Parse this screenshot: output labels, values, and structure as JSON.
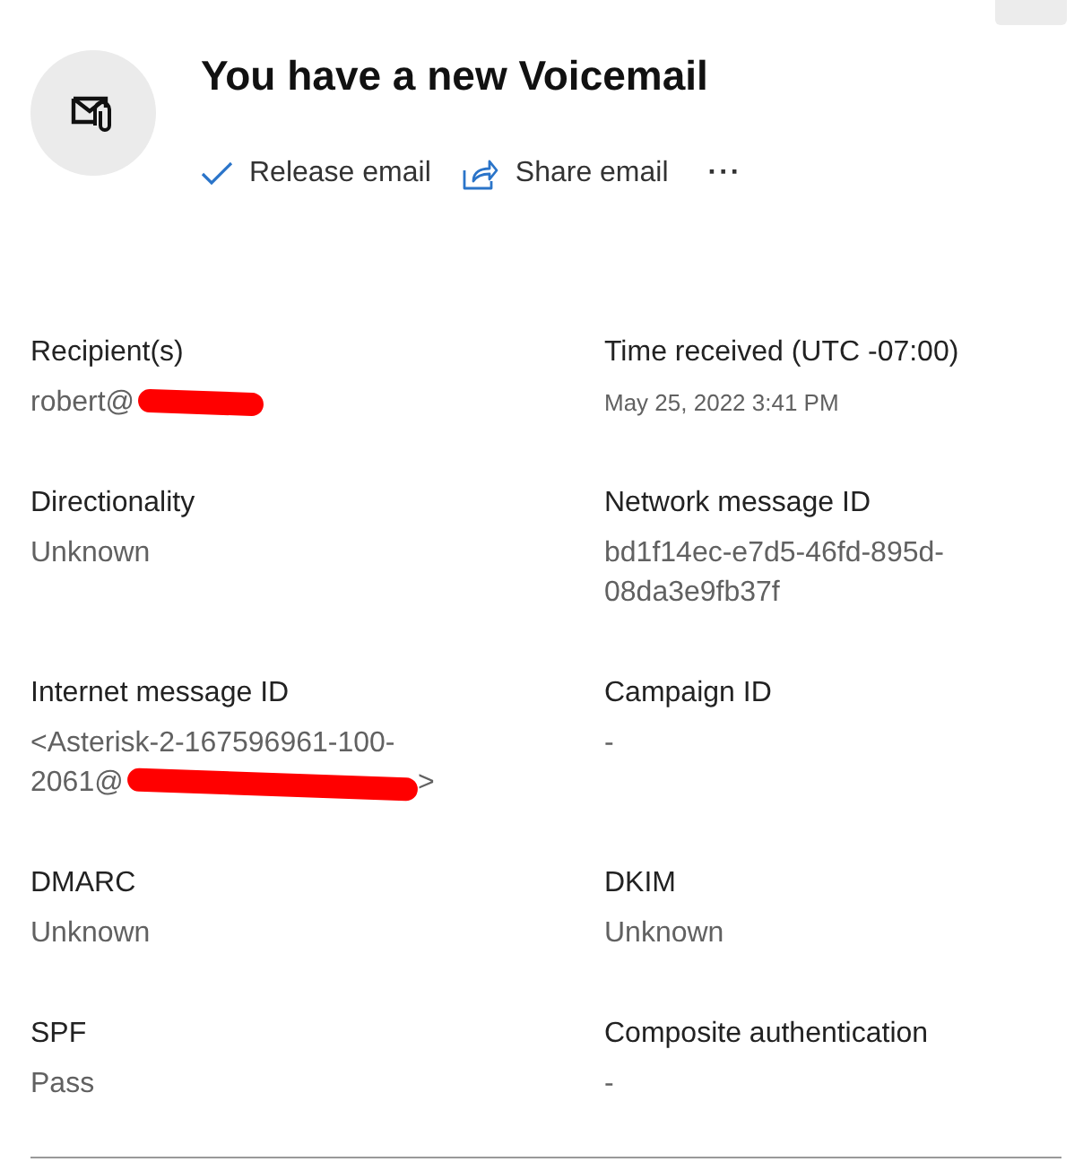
{
  "header": {
    "title": "You have a new Voicemail",
    "actions": [
      {
        "kind": "release",
        "label": "Release email"
      },
      {
        "kind": "share",
        "label": "Share email"
      },
      {
        "kind": "more",
        "label": "···"
      }
    ]
  },
  "fields": [
    {
      "label": "Recipient(s)",
      "value": "robert@",
      "redacted": true
    },
    {
      "label": "Time received (UTC -07:00)",
      "value": "May 25, 2022 3:41 PM",
      "small": true
    },
    {
      "label": "Directionality",
      "value": "Unknown"
    },
    {
      "label": "Network message ID",
      "value": "bd1f14ec-e7d5-46fd-895d-08da3e9fb37f"
    },
    {
      "label": "Internet message ID",
      "value": "<Asterisk-2-167596961-100-2061@",
      "redacted": true,
      "suffix": ">"
    },
    {
      "label": "Campaign ID",
      "value": "-"
    },
    {
      "label": "DMARC",
      "value": "Unknown"
    },
    {
      "label": "DKIM",
      "value": "Unknown"
    },
    {
      "label": "SPF",
      "value": "Pass"
    },
    {
      "label": "Composite authentication",
      "value": "-"
    }
  ]
}
